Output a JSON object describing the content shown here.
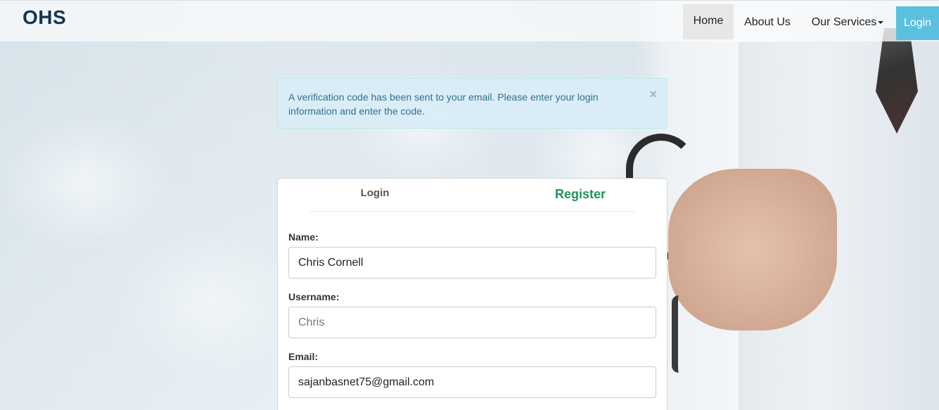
{
  "navbar": {
    "brand": "OHS",
    "items": [
      {
        "label": "Home"
      },
      {
        "label": "About Us"
      },
      {
        "label": "Our Services"
      }
    ],
    "login_button": "Login"
  },
  "alert": {
    "message": "A verification code has been sent to your email. Please enter your login information and enter the code.",
    "close_symbol": "×"
  },
  "form": {
    "tabs": {
      "login": "Login",
      "register": "Register"
    },
    "fields": [
      {
        "label": "Name:",
        "value": "Chris Cornell"
      },
      {
        "label": "Username:",
        "placeholder": "Chris"
      },
      {
        "label": "Email:",
        "value": "sajanbasnet75@gmail.com"
      }
    ]
  },
  "colors": {
    "brand": "#15344f",
    "active_tab": "#1e9654",
    "login_button": "#5bc0de",
    "alert_bg": "#d9edf7",
    "alert_text": "#31708f"
  }
}
